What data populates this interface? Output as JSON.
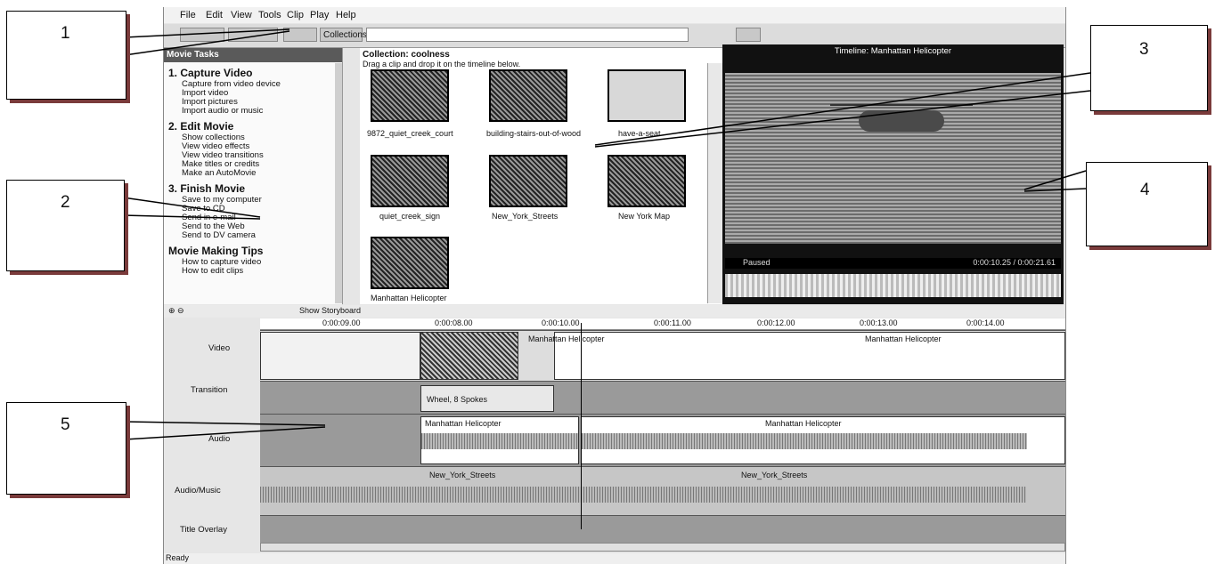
{
  "menu": [
    "File",
    "Edit",
    "View",
    "Tools",
    "Clip",
    "Play",
    "Help"
  ],
  "toolbar": {
    "collections_label": "Collections"
  },
  "tasks": {
    "header": "Movie Tasks",
    "sections": [
      {
        "title": "1. Capture Video",
        "items": [
          "Capture from video device",
          "Import video",
          "Import pictures",
          "Import audio or music"
        ]
      },
      {
        "title": "2. Edit Movie",
        "items": [
          "Show collections",
          "View video effects",
          "View video transitions",
          "Make titles or credits",
          "Make an AutoMovie"
        ]
      },
      {
        "title": "3. Finish Movie",
        "items": [
          "Save to my computer",
          "Save to CD",
          "Send in e-mail",
          "Send to the Web",
          "Send to DV camera"
        ]
      },
      {
        "title": "Movie Making Tips",
        "items": [
          "How to capture video",
          "How to edit clips"
        ]
      }
    ]
  },
  "collection": {
    "title": "Collection: coolness",
    "subtitle": "Drag a clip and drop it on the timeline below.",
    "clips": [
      "9872_quiet_creek_court",
      "building-stairs-out-of-wood",
      "have-a-seat",
      "quiet_creek_sign",
      "New_York_Streets",
      "New York Map",
      "Manhattan Helicopter"
    ]
  },
  "preview": {
    "title": "Timeline: Manhattan Helicopter",
    "status": "Paused",
    "time": "0:00:10.25 / 0:00:21.61"
  },
  "timeline": {
    "toolbar_label": "Show Storyboard",
    "ruler": [
      "0:00:09.00",
      "0:00:08.00",
      "0:00:10.00",
      "0:00:11.00",
      "0:00:12.00",
      "0:00:13.00",
      "0:00:14.00"
    ],
    "tracks": [
      "Video",
      "Transition",
      "Audio",
      "Audio/Music",
      "Title Overlay"
    ],
    "video_clips": [
      "Manhattan Helicopter",
      "Manhattan Helicopter"
    ],
    "transition_label": "Wheel, 8 Spokes",
    "audio_clips": [
      "Manhattan Helicopter",
      "Manhattan Helicopter"
    ],
    "music_clips": [
      "New_York_Streets",
      "New_York_Streets"
    ]
  },
  "status": "Ready",
  "callouts": [
    "1",
    "2",
    "3",
    "4",
    "5"
  ]
}
